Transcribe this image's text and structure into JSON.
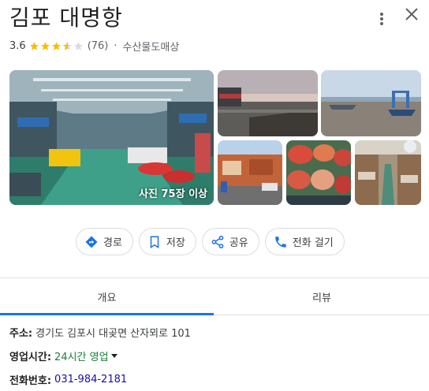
{
  "place": {
    "title": "김포 대명항",
    "rating": "3.6",
    "stars_value": 3.6,
    "stars_max": 5,
    "review_count": "(76)",
    "separator": "·",
    "category": "수산물도매상"
  },
  "photos": {
    "count_label": "사진 75장 이상"
  },
  "actions": [
    {
      "label": "경로",
      "icon": "directions-icon"
    },
    {
      "label": "저장",
      "icon": "bookmark-icon"
    },
    {
      "label": "공유",
      "icon": "share-icon"
    },
    {
      "label": "전화 걸기",
      "icon": "phone-icon"
    }
  ],
  "tabs": [
    {
      "label": "개요",
      "active": true
    },
    {
      "label": "리뷰",
      "active": false
    }
  ],
  "info": {
    "address_label": "주소:",
    "address": "경기도 김포시 대곶면 산자뫼로 101",
    "hours_label": "영업시간:",
    "hours": "24시간 영업",
    "phone_label": "전화번호:",
    "phone": "031-984-2181"
  },
  "colors": {
    "star": "#fbbc04",
    "accent": "#1a73e8",
    "hours_green": "#188038",
    "link": "#1a0dab"
  }
}
